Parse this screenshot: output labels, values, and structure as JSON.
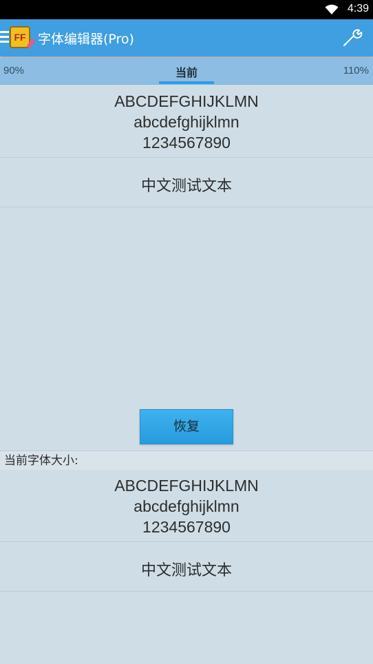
{
  "status": {
    "time": "4:39"
  },
  "appbar": {
    "title": "字体编辑器(Pro)",
    "menu_icon": "menu-icon",
    "logo_icon": "font-editor-logo-icon",
    "settings_icon": "wrench-icon"
  },
  "tabs": {
    "left": "90%",
    "current": "当前",
    "right": "110%"
  },
  "preview": {
    "upper": "ABCDEFGHIJKLMN",
    "lower": "abcdefghijklmn",
    "digits": "1234567890",
    "chinese": "中文测试文本"
  },
  "restore_button": "恢复",
  "current_size_label": "当前字体大小:",
  "current_preview": {
    "upper": "ABCDEFGHIJKLMN",
    "lower": "abcdefghijklmn",
    "digits": "1234567890",
    "chinese": "中文测试文本"
  },
  "colors": {
    "appbar": "#3f9fe0",
    "tabbar": "#8dbde2",
    "background": "#cfdde6",
    "accent": "#2f9ee6"
  }
}
